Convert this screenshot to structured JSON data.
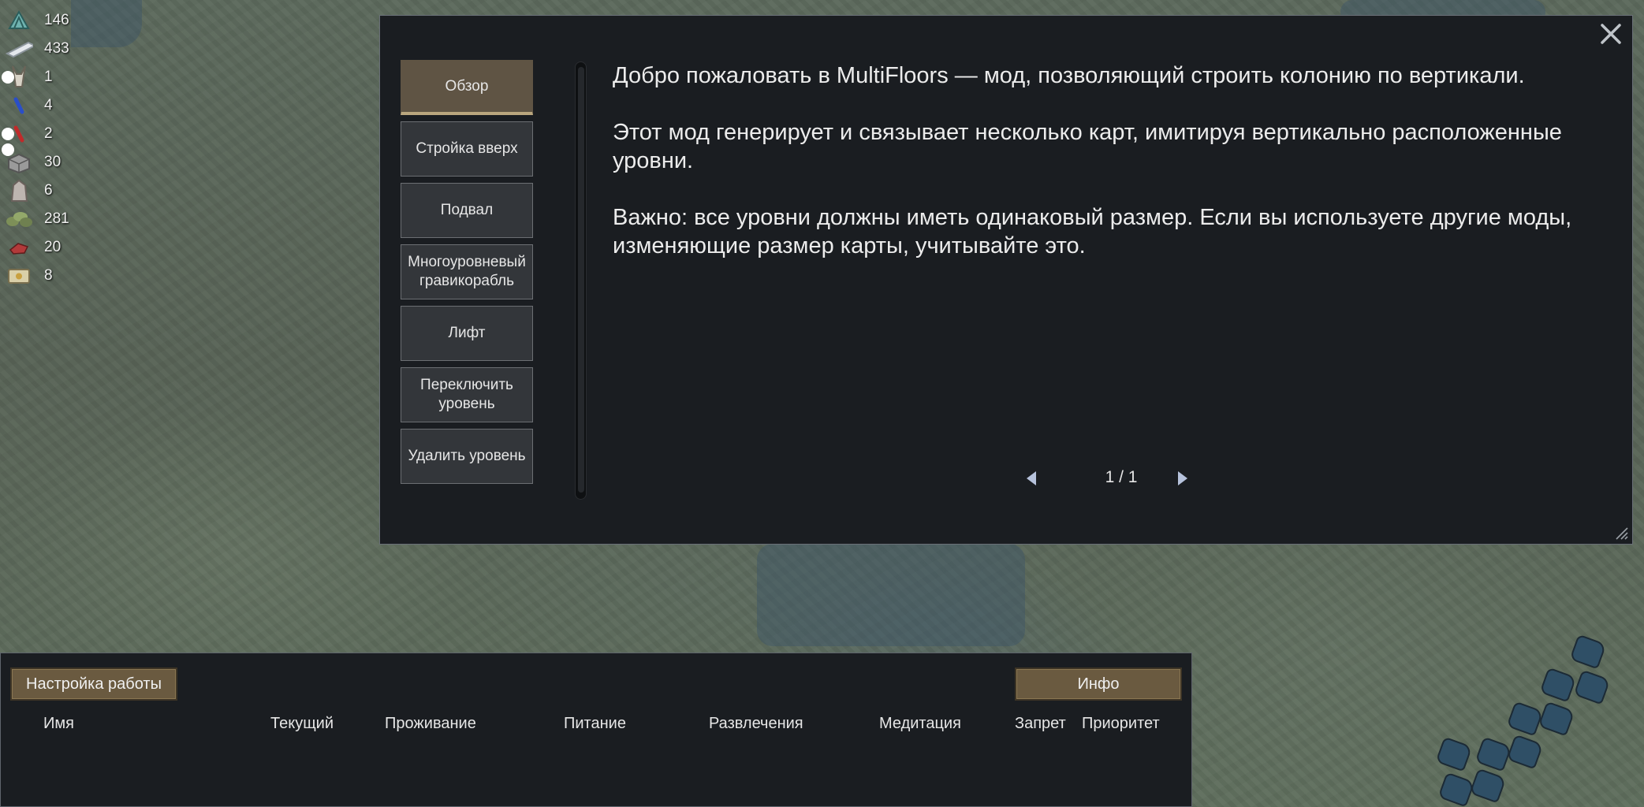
{
  "resources": [
    {
      "icon": "shell-icon",
      "value": "146"
    },
    {
      "icon": "steel-bar-icon",
      "value": "433"
    },
    {
      "icon": "skull-icon",
      "value": "1"
    },
    {
      "icon": "blue-vial-icon",
      "value": "4"
    },
    {
      "icon": "red-vial-icon",
      "value": "2"
    },
    {
      "icon": "stone-block-icon",
      "value": "30"
    },
    {
      "icon": "stone-chunk-icon",
      "value": "6"
    },
    {
      "icon": "herbs-icon",
      "value": "281"
    },
    {
      "icon": "meat-icon",
      "value": "20"
    },
    {
      "icon": "silver-icon",
      "value": "8"
    }
  ],
  "dialog": {
    "nav": [
      {
        "label": "Обзор",
        "active": true
      },
      {
        "label": "Стройка вверх"
      },
      {
        "label": "Подвал"
      },
      {
        "label_lines": [
          "Многоуровневый",
          "гравикорабль"
        ]
      },
      {
        "label": "Лифт"
      },
      {
        "label_lines": [
          "Переключить",
          "уровень"
        ]
      },
      {
        "label": "Удалить уровень"
      }
    ],
    "paragraphs": [
      "Добро пожаловать в MultiFloors — мод, позволяющий строить колонию по вертикали.",
      "Этот мод генерирует и связывает несколько карт, имитируя вертикально расположенные уровни.",
      "Важно: все уровни должны иметь одинаковый размер. Если вы используете другие моды, изменяющие размер карты, учитывайте это."
    ],
    "pager": "1 / 1"
  },
  "work_panel": {
    "settings_button": "Настройка работы",
    "info_button": "Инфо",
    "columns": [
      "Имя",
      "Текущий",
      "Проживание",
      "Питание",
      "Развлечения",
      "Медитация",
      "Запрет",
      "Приоритет"
    ]
  }
}
